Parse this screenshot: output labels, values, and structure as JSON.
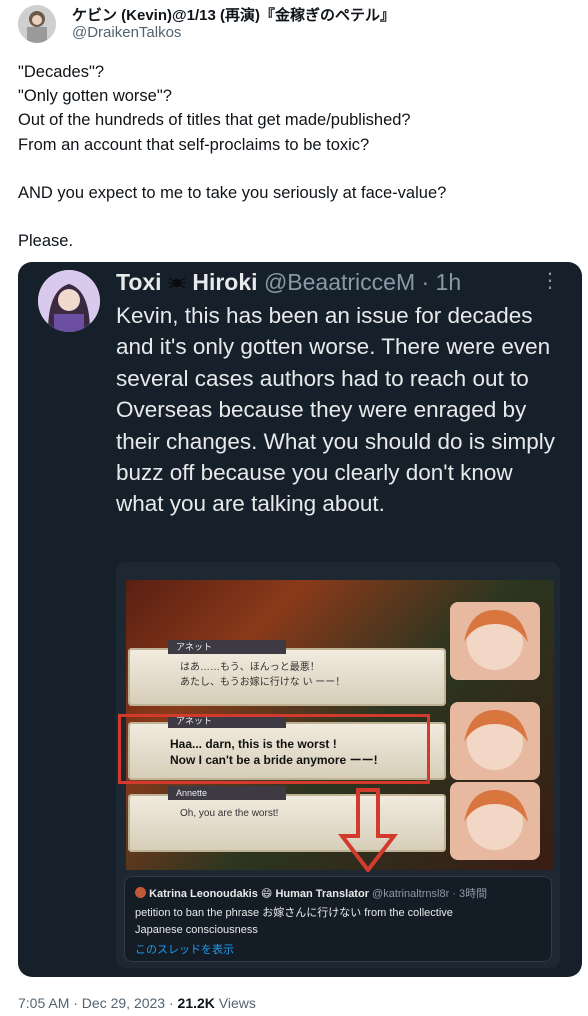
{
  "author": {
    "display_name": "ケビン (Kevin)@1/13 (再演)『金稼ぎのペテル』",
    "handle": "@DraikenTalkos"
  },
  "tweet_text": "\"Decades\"?\n\"Only gotten worse\"?\nOut of the hundreds of titles that get made/published?\nFrom an account that self-proclaims to be toxic?\n\nAND you expect to me to take you seriously at face-value?\n\nPlease.",
  "quoted": {
    "name_part1": "Toxi",
    "name_part2": "Hiroki",
    "handle_time": "@BeaatricceM · 1h",
    "more": "⋮",
    "text": "Kevin, this has been an issue for decades and it's only gotten worse. There were even several cases authors had to reach out to Overseas because they were enraged by their changes. What you should do is simply buzz off because you clearly don't know what you are talking about.",
    "game": {
      "box1_name": "アネット",
      "box1_text": "はあ……もう、ほんっと最悪！\nあたし、もうお嫁に行けな い ーー！",
      "box2_name": "アネット",
      "box2_text": "Haa... darn, this is the worst !\nNow I can't be a bride anymore ーー!",
      "box3_name": "Annette",
      "box3_text": "Oh, you are the worst!"
    },
    "embed": {
      "name": "Katrina Leonoudakis",
      "title": "Human Translator",
      "handle_time": "@katrinaltrnsl8r · 3時間",
      "text": "petition to ban the phrase お嫁さんに行けない from the collective\nJapanese consciousness",
      "link": "このスレッドを表示"
    }
  },
  "footer": {
    "time": "7:05 AM · Dec 29, 2023 · ",
    "views_count": "21.2K",
    "views_label": " Views"
  }
}
